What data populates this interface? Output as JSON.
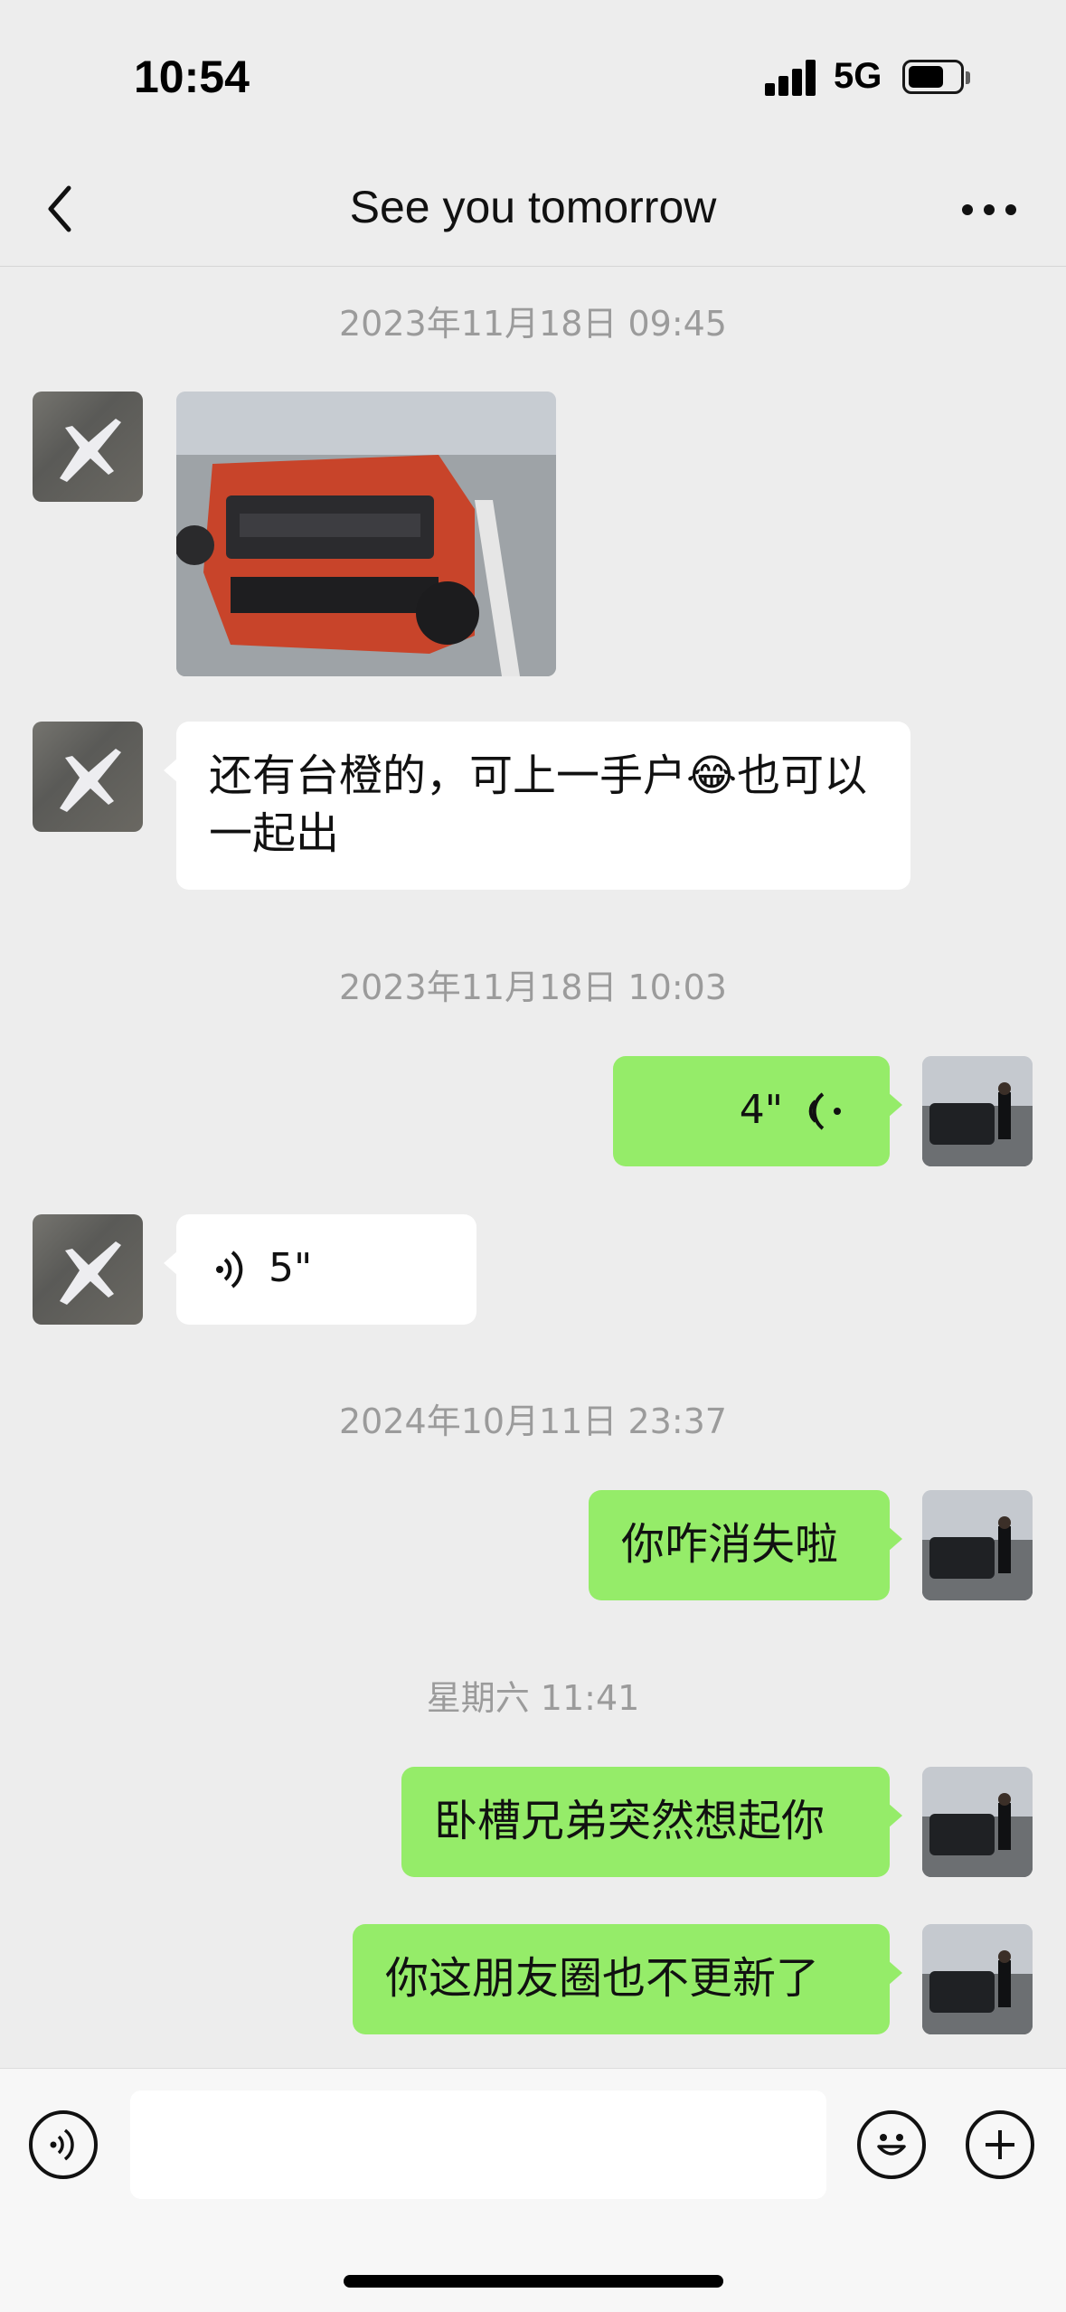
{
  "status_bar": {
    "time": "10:54",
    "network": "5G"
  },
  "nav": {
    "title": "See you tomorrow"
  },
  "messages": [
    {
      "type": "timestamp",
      "text": "2023年11月18日 09:45"
    },
    {
      "type": "image",
      "direction": "incoming"
    },
    {
      "type": "text",
      "direction": "incoming",
      "text": "还有台橙的，可上一手户😂也可以一起出"
    },
    {
      "type": "timestamp",
      "text": "2023年11月18日 10:03"
    },
    {
      "type": "voice",
      "direction": "outgoing",
      "duration": "4\""
    },
    {
      "type": "voice",
      "direction": "incoming",
      "duration": "5\""
    },
    {
      "type": "timestamp",
      "text": "2024年10月11日 23:37"
    },
    {
      "type": "text",
      "direction": "outgoing",
      "text": "你咋消失啦"
    },
    {
      "type": "timestamp",
      "text": "星期六 11:41"
    },
    {
      "type": "text",
      "direction": "outgoing",
      "text": "卧槽兄弟突然想起你"
    },
    {
      "type": "text",
      "direction": "outgoing",
      "text": "你这朋友圈也不更新了"
    }
  ],
  "input_bar": {
    "placeholder": ""
  },
  "colors": {
    "outgoing_bubble": "#95ec69",
    "incoming_bubble": "#ffffff",
    "background": "#ededed",
    "timestamp": "#9b9b9b"
  },
  "icons": [
    "back-icon",
    "more-icon",
    "voice-icon",
    "emoji-icon",
    "plus-icon"
  ]
}
